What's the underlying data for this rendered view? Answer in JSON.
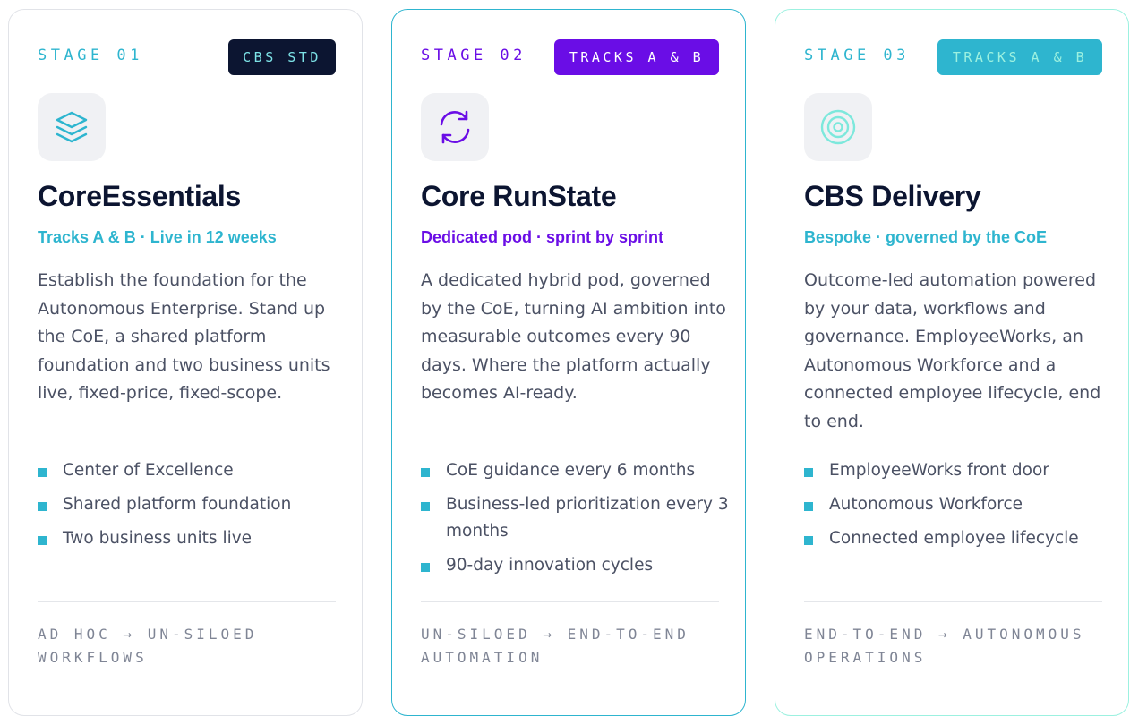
{
  "cards": [
    {
      "stage": "STAGE 01",
      "badge": "CBS STD",
      "title": "CoreEssentials",
      "subtitle": "Tracks A & B · Live in 12 weeks",
      "description": "Establish the foundation for the Autonomous Enterprise. Stand up the CoE, a shared platform foundation and two business units live, fixed-price, fixed-scope.",
      "bullets": [
        "Center of Excellence",
        "Shared platform foundation",
        "Two business units live"
      ],
      "footer": "AD HOC → UN-SILOED WORKFLOWS",
      "icon": "layers-icon",
      "accent": "#2eb5cf"
    },
    {
      "stage": "STAGE 02",
      "badge": "TRACKS A & B",
      "title": "Core RunState",
      "subtitle": "Dedicated pod · sprint by sprint",
      "description": "A dedicated hybrid pod, governed by the CoE, turning AI ambition into measurable outcomes every 90 days. Where the platform actually becomes AI-ready.",
      "bullets": [
        "CoE guidance every 6 months",
        "Business-led prioritization every 3 months",
        "90-day innovation cycles"
      ],
      "footer": "UN-SILOED → END-TO-END AUTOMATION",
      "icon": "refresh-icon",
      "accent": "#6a0de6"
    },
    {
      "stage": "STAGE 03",
      "badge": "TRACKS A & B",
      "title": "CBS Delivery",
      "subtitle": "Bespoke · governed by the CoE",
      "description": "Outcome-led automation powered by your data, workflows and governance. EmployeeWorks, an Autonomous Workforce and a connected employee lifecycle, end to end.",
      "bullets": [
        "EmployeeWorks front door",
        "Autonomous Workforce",
        "Connected employee lifecycle"
      ],
      "footer": "END-TO-END → AUTONOMOUS OPERATIONS",
      "icon": "target-icon",
      "accent": "#2eb5cf"
    }
  ]
}
